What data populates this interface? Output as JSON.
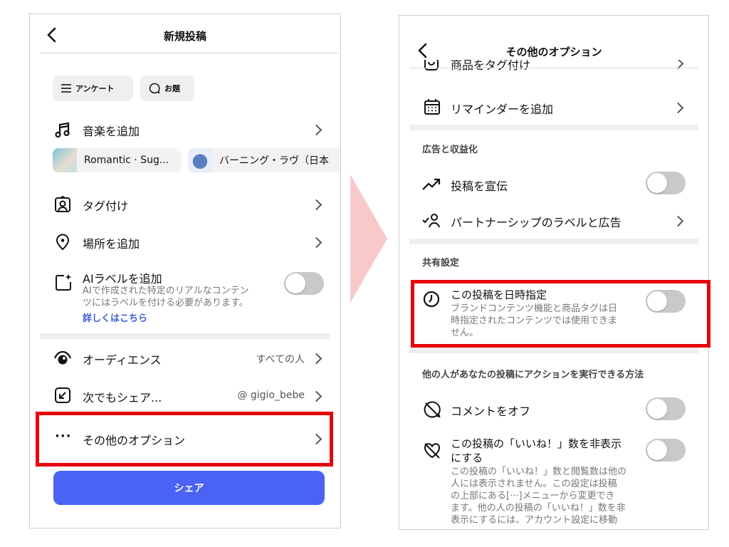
{
  "left": {
    "title": "新規投稿",
    "chips": [
      {
        "label": "アンケート",
        "icon": "list-icon"
      },
      {
        "label": "お題",
        "icon": "speech-bubble-icon"
      }
    ],
    "music": {
      "label": "音楽を追加",
      "tracks": [
        "Romantic · Sug...",
        "バーニング・ラヴ（日本"
      ]
    },
    "tag": "タグ付け",
    "location": "場所を追加",
    "ai_label": {
      "title": "AIラベルを追加",
      "desc_1": "AIで作成された特定のリアルなコンテン",
      "desc_2": "ツにはラベルを付ける必要があります。",
      "link": "詳しくはこちら"
    },
    "audience": {
      "label": "オーディエンス",
      "value": "すべての人"
    },
    "share_to": {
      "label": "次でもシェア...",
      "value": "@ gigio_bebe"
    },
    "more_options": {
      "label": "その他のオプション"
    },
    "share_button": "シェア"
  },
  "right": {
    "title": "その他のオプション",
    "product_tag": "商品をタグ付け",
    "reminder": "リマインダーを追加",
    "section_ads": "広告と収益化",
    "promote": "投稿を宣伝",
    "partnership": "パートナーシップのラベルと広告",
    "section_share": "共有設定",
    "schedule": {
      "title": "この投稿を日時指定",
      "desc_1": "ブランドコンテンツ機能と商品タグは日",
      "desc_2": "時指定されたコンテンツでは使用できま",
      "desc_3": "せん。"
    },
    "section_actions": "他の人があなたの投稿にアクションを実行できる方法",
    "comments_off": "コメントをオフ",
    "hide_likes": {
      "title_1": "この投稿の「いいね！」数を非表示",
      "title_2": "にする",
      "desc_1": "この投稿の「いいね！」数と閲覧数は他の",
      "desc_2": "人には表示されません。この設定は投稿",
      "desc_3": "の上部にある[···]メニューから変更でき",
      "desc_4": "ます。他の人の投稿の「いいね！」数を非",
      "desc_5": "表示にするには、アカウント設定に移動"
    }
  },
  "colors": {
    "highlight": "#e8000b",
    "share_button": "#4a63f4",
    "link": "#3b5bdb",
    "arrow": "#f8c9c9"
  }
}
